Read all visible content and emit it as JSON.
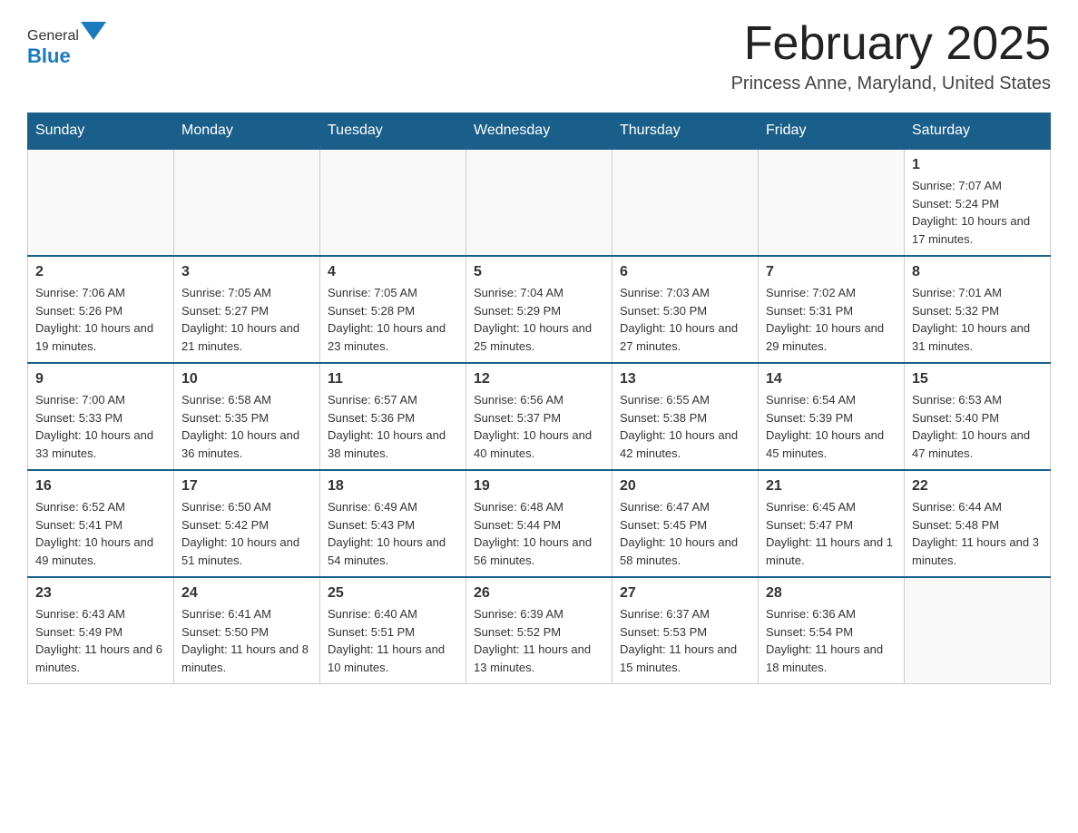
{
  "header": {
    "logo_general": "General",
    "logo_blue": "Blue",
    "month_title": "February 2025",
    "location": "Princess Anne, Maryland, United States"
  },
  "weekdays": [
    "Sunday",
    "Monday",
    "Tuesday",
    "Wednesday",
    "Thursday",
    "Friday",
    "Saturday"
  ],
  "weeks": [
    [
      {
        "day": "",
        "info": ""
      },
      {
        "day": "",
        "info": ""
      },
      {
        "day": "",
        "info": ""
      },
      {
        "day": "",
        "info": ""
      },
      {
        "day": "",
        "info": ""
      },
      {
        "day": "",
        "info": ""
      },
      {
        "day": "1",
        "info": "Sunrise: 7:07 AM\nSunset: 5:24 PM\nDaylight: 10 hours and 17 minutes."
      }
    ],
    [
      {
        "day": "2",
        "info": "Sunrise: 7:06 AM\nSunset: 5:26 PM\nDaylight: 10 hours and 19 minutes."
      },
      {
        "day": "3",
        "info": "Sunrise: 7:05 AM\nSunset: 5:27 PM\nDaylight: 10 hours and 21 minutes."
      },
      {
        "day": "4",
        "info": "Sunrise: 7:05 AM\nSunset: 5:28 PM\nDaylight: 10 hours and 23 minutes."
      },
      {
        "day": "5",
        "info": "Sunrise: 7:04 AM\nSunset: 5:29 PM\nDaylight: 10 hours and 25 minutes."
      },
      {
        "day": "6",
        "info": "Sunrise: 7:03 AM\nSunset: 5:30 PM\nDaylight: 10 hours and 27 minutes."
      },
      {
        "day": "7",
        "info": "Sunrise: 7:02 AM\nSunset: 5:31 PM\nDaylight: 10 hours and 29 minutes."
      },
      {
        "day": "8",
        "info": "Sunrise: 7:01 AM\nSunset: 5:32 PM\nDaylight: 10 hours and 31 minutes."
      }
    ],
    [
      {
        "day": "9",
        "info": "Sunrise: 7:00 AM\nSunset: 5:33 PM\nDaylight: 10 hours and 33 minutes."
      },
      {
        "day": "10",
        "info": "Sunrise: 6:58 AM\nSunset: 5:35 PM\nDaylight: 10 hours and 36 minutes."
      },
      {
        "day": "11",
        "info": "Sunrise: 6:57 AM\nSunset: 5:36 PM\nDaylight: 10 hours and 38 minutes."
      },
      {
        "day": "12",
        "info": "Sunrise: 6:56 AM\nSunset: 5:37 PM\nDaylight: 10 hours and 40 minutes."
      },
      {
        "day": "13",
        "info": "Sunrise: 6:55 AM\nSunset: 5:38 PM\nDaylight: 10 hours and 42 minutes."
      },
      {
        "day": "14",
        "info": "Sunrise: 6:54 AM\nSunset: 5:39 PM\nDaylight: 10 hours and 45 minutes."
      },
      {
        "day": "15",
        "info": "Sunrise: 6:53 AM\nSunset: 5:40 PM\nDaylight: 10 hours and 47 minutes."
      }
    ],
    [
      {
        "day": "16",
        "info": "Sunrise: 6:52 AM\nSunset: 5:41 PM\nDaylight: 10 hours and 49 minutes."
      },
      {
        "day": "17",
        "info": "Sunrise: 6:50 AM\nSunset: 5:42 PM\nDaylight: 10 hours and 51 minutes."
      },
      {
        "day": "18",
        "info": "Sunrise: 6:49 AM\nSunset: 5:43 PM\nDaylight: 10 hours and 54 minutes."
      },
      {
        "day": "19",
        "info": "Sunrise: 6:48 AM\nSunset: 5:44 PM\nDaylight: 10 hours and 56 minutes."
      },
      {
        "day": "20",
        "info": "Sunrise: 6:47 AM\nSunset: 5:45 PM\nDaylight: 10 hours and 58 minutes."
      },
      {
        "day": "21",
        "info": "Sunrise: 6:45 AM\nSunset: 5:47 PM\nDaylight: 11 hours and 1 minute."
      },
      {
        "day": "22",
        "info": "Sunrise: 6:44 AM\nSunset: 5:48 PM\nDaylight: 11 hours and 3 minutes."
      }
    ],
    [
      {
        "day": "23",
        "info": "Sunrise: 6:43 AM\nSunset: 5:49 PM\nDaylight: 11 hours and 6 minutes."
      },
      {
        "day": "24",
        "info": "Sunrise: 6:41 AM\nSunset: 5:50 PM\nDaylight: 11 hours and 8 minutes."
      },
      {
        "day": "25",
        "info": "Sunrise: 6:40 AM\nSunset: 5:51 PM\nDaylight: 11 hours and 10 minutes."
      },
      {
        "day": "26",
        "info": "Sunrise: 6:39 AM\nSunset: 5:52 PM\nDaylight: 11 hours and 13 minutes."
      },
      {
        "day": "27",
        "info": "Sunrise: 6:37 AM\nSunset: 5:53 PM\nDaylight: 11 hours and 15 minutes."
      },
      {
        "day": "28",
        "info": "Sunrise: 6:36 AM\nSunset: 5:54 PM\nDaylight: 11 hours and 18 minutes."
      },
      {
        "day": "",
        "info": ""
      }
    ]
  ]
}
